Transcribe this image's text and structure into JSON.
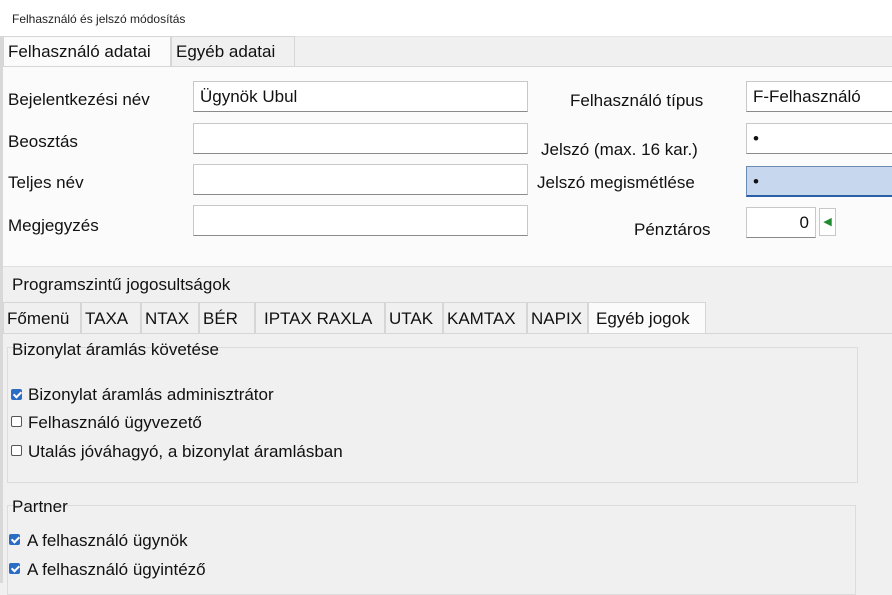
{
  "window": {
    "title": "Felhasználó és jelszó módosítás"
  },
  "tabs": [
    "Felhasználó adatai",
    "Egyéb adatai"
  ],
  "form": {
    "login_label": "Bejelentkezési név",
    "login_value": "Ügynök Ubul",
    "position_label": "Beosztás",
    "position_value": "",
    "fullname_label": "Teljes név",
    "fullname_value": "",
    "note_label": "Megjegyzés",
    "note_value": "",
    "user_type_label": "Felhasználó típus",
    "user_type_value": "F-Felhasználó",
    "password_label": "Jelszó (max. 16 kar.)",
    "password_value": "•",
    "password_repeat_label": "Jelszó megismétlése",
    "password_repeat_value": "•",
    "cashier_label": "Pénztáros",
    "cashier_value": "0"
  },
  "permissions": {
    "title": "Programszintű jogosultságok",
    "tabs": [
      "Főmenü",
      "TAXA",
      "NTAX",
      "BÉR",
      "IPTAX RAXLA",
      "UTAK",
      "KAMTAX",
      "NAPIX",
      "Egyéb jogok"
    ],
    "active_tab": "Egyéb jogok"
  },
  "groups": {
    "workflow": {
      "title": "Bizonylat áramlás követése",
      "items": [
        {
          "label": "Bizonylat áramlás adminisztrátor",
          "checked": true
        },
        {
          "label": "Felhasználó ügyvezető",
          "checked": false
        },
        {
          "label": "Utalás jóváhagyó, a bizonylat áramlásban",
          "checked": false
        }
      ]
    },
    "partner": {
      "title": "Partner",
      "items": [
        {
          "label": "A felhasználó ügynök",
          "checked": true
        },
        {
          "label": "A felhasználó ügyintéző",
          "checked": true
        }
      ]
    }
  },
  "colors": {
    "accent": "#2b6cc4",
    "focus_fill": "#c7d8ee",
    "spinner_arrow": "#1f8a2e"
  }
}
